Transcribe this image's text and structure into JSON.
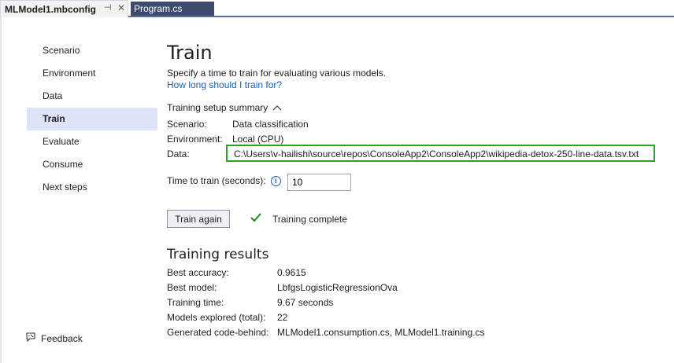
{
  "tabs": {
    "active_title": "MLModel1.mbconfig",
    "pin_glyph": "⊣",
    "close_glyph": "✕",
    "inactive_title": "Program.cs"
  },
  "sidebar": {
    "items": [
      {
        "label": "Scenario"
      },
      {
        "label": "Environment"
      },
      {
        "label": "Data"
      },
      {
        "label": "Train"
      },
      {
        "label": "Evaluate"
      },
      {
        "label": "Consume"
      },
      {
        "label": "Next steps"
      }
    ],
    "active_index": 3,
    "feedback_label": "Feedback"
  },
  "main": {
    "title": "Train",
    "description": "Specify a time to train for evaluating various models.",
    "help_link": "How long should I train for?",
    "summary_toggle": "Training setup summary",
    "summary": {
      "scenario_label": "Scenario:",
      "scenario_value": "Data classification",
      "environment_label": "Environment:",
      "environment_value": "Local (CPU)",
      "data_label": "Data:",
      "data_value": "C:\\Users\\v-hailishi\\source\\repos\\ConsoleApp2\\ConsoleApp2\\wikipedia-detox-250-line-data.tsv.txt"
    },
    "time_label": "Time to train (seconds):",
    "time_value": "10",
    "train_button": "Train again",
    "status_text": "Training complete",
    "results_title": "Training results",
    "results": [
      {
        "label": "Best accuracy:",
        "value": "0.9615"
      },
      {
        "label": "Best model:",
        "value": "LbfgsLogisticRegressionOva"
      },
      {
        "label": "Training time:",
        "value": "9.67 seconds"
      },
      {
        "label": "Models explored (total):",
        "value": "22"
      },
      {
        "label": "Generated code-behind:",
        "value": "MLModel1.consumption.cs, MLModel1.training.cs"
      }
    ]
  },
  "colors": {
    "accent_link": "#1a5fb4",
    "highlight_box": "#2aa12a",
    "active_nav_bg": "#dfe3f7",
    "success_check": "#1e8a1e"
  }
}
